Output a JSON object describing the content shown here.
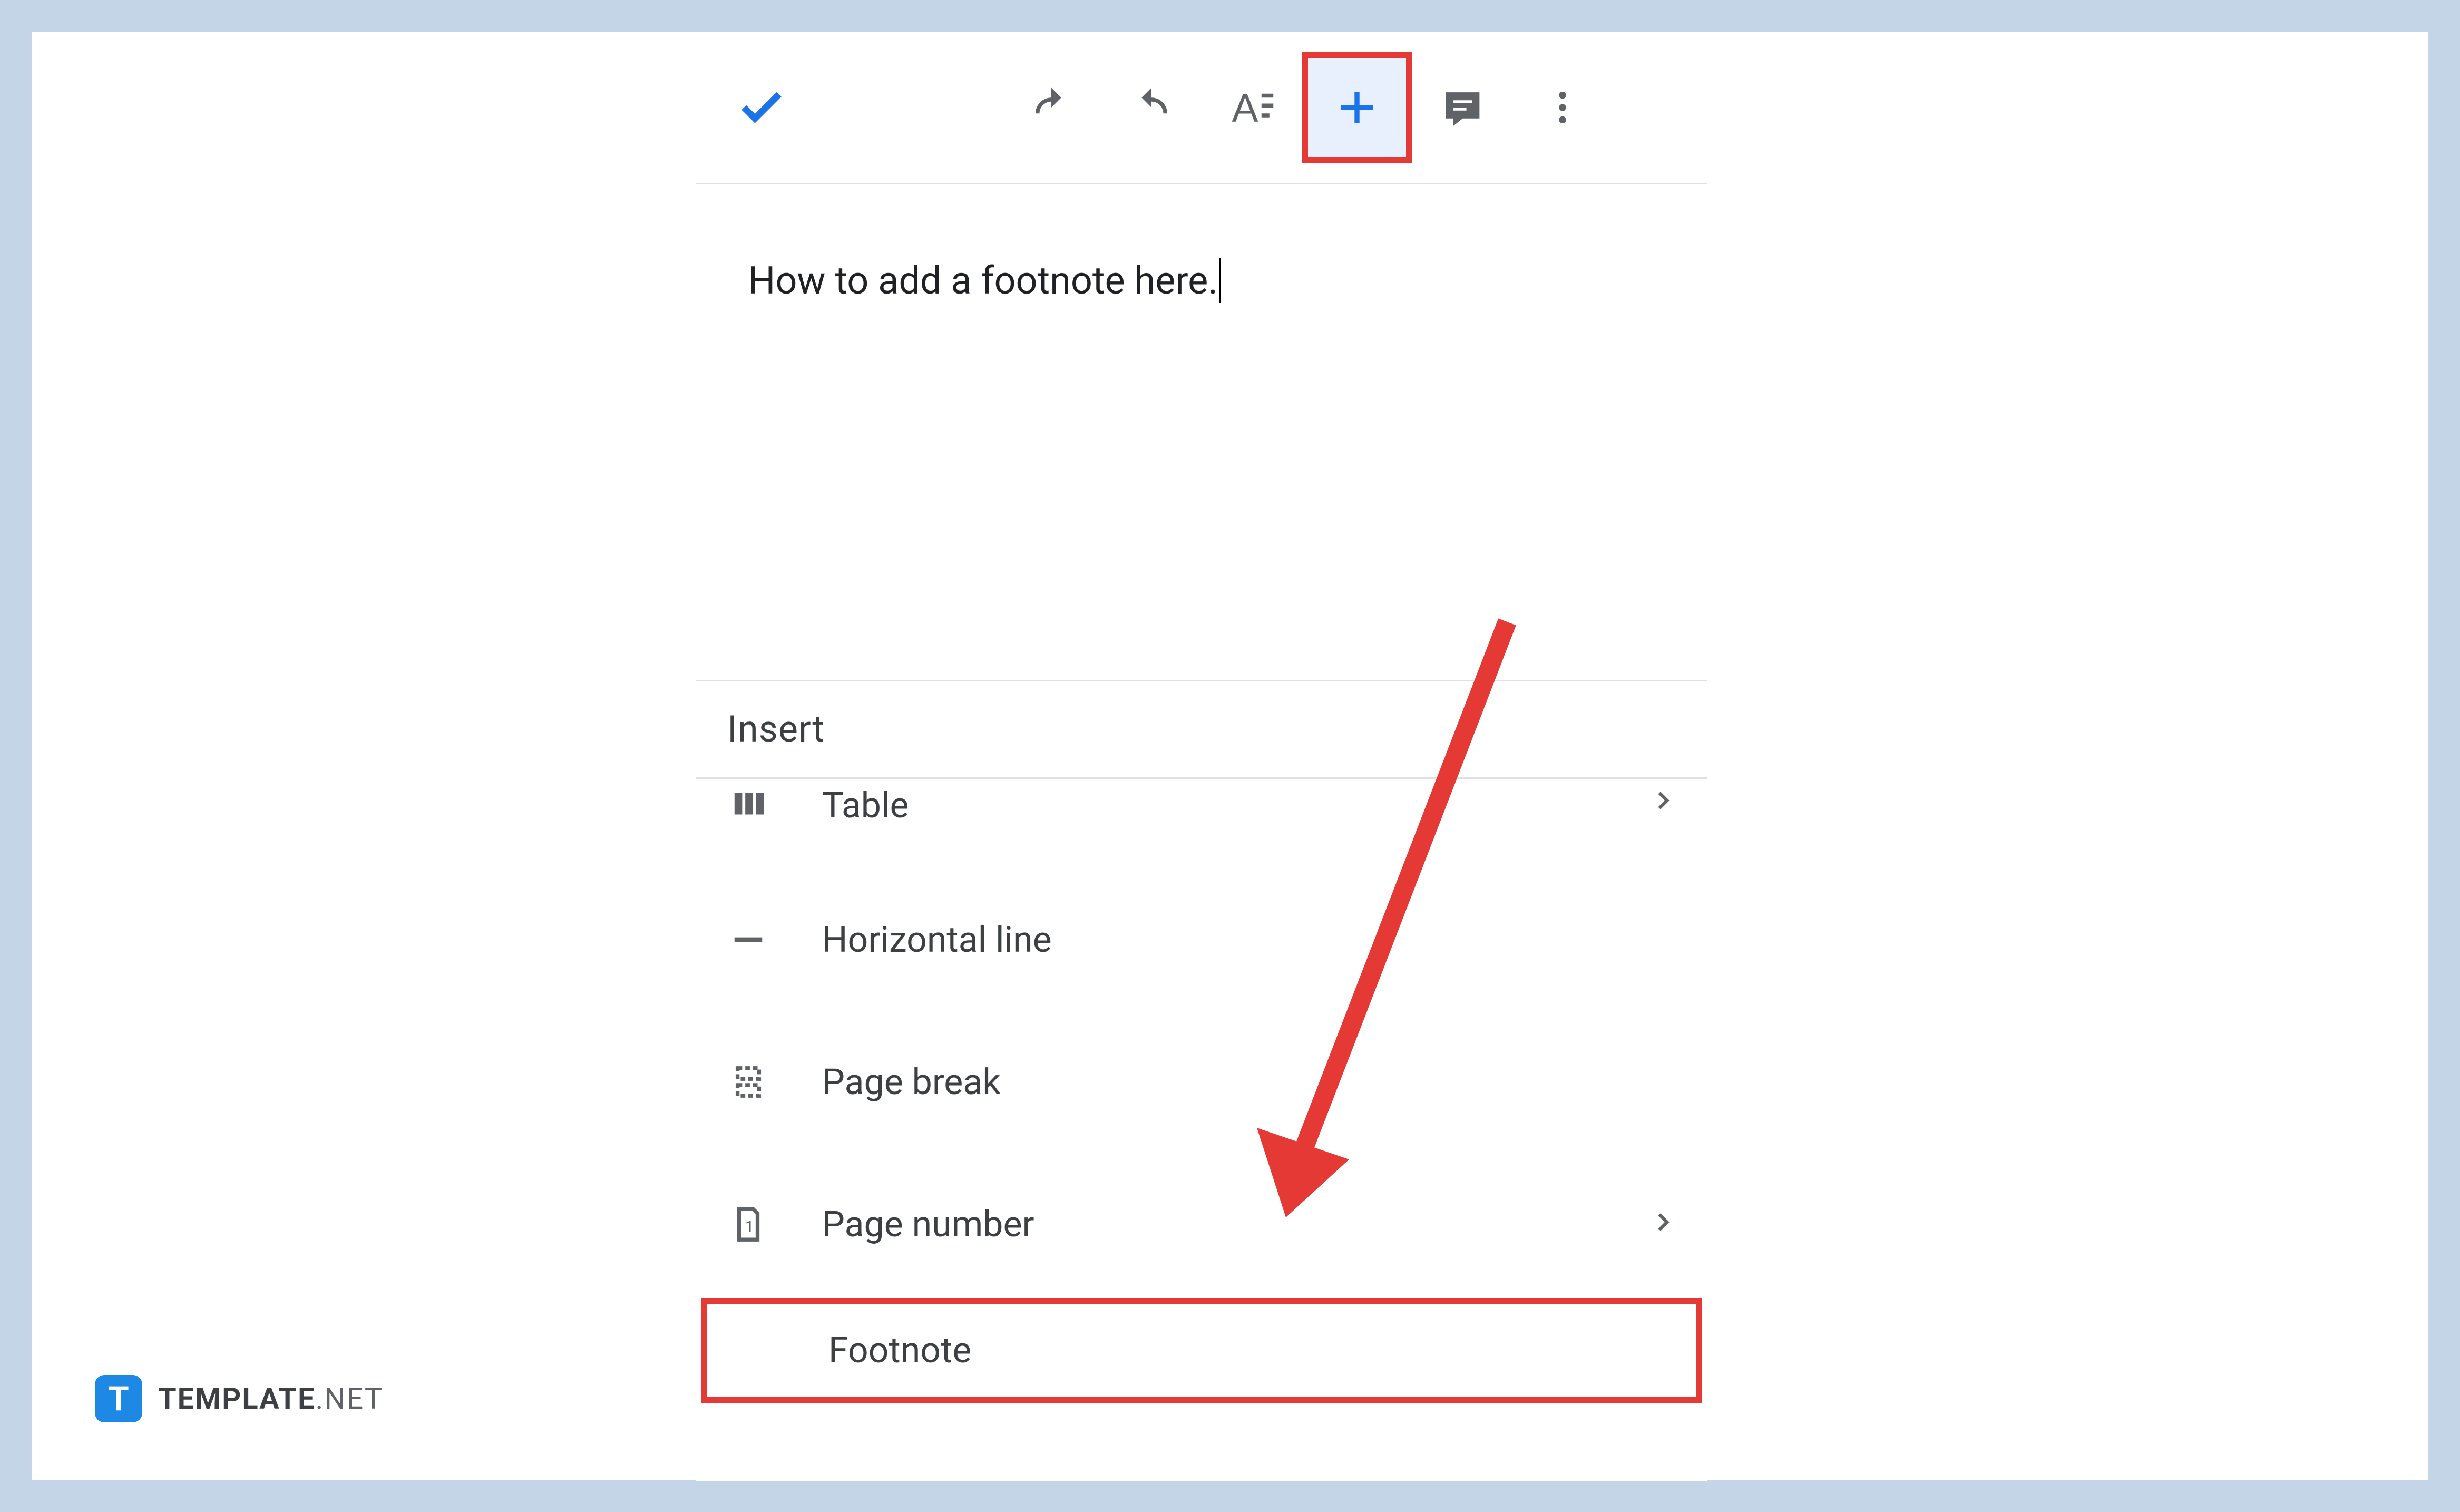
{
  "document": {
    "text": "How to add a footnote here."
  },
  "toolbar": {
    "check": "✓",
    "undo": "↶",
    "redo": "↷",
    "format": "A",
    "plus": "+",
    "comment": "💬",
    "more": "⋮"
  },
  "insert_panel": {
    "title": "Insert",
    "items": [
      {
        "icon": "table-icon",
        "label": "Table",
        "has_submenu": true
      },
      {
        "icon": "hline-icon",
        "label": "Horizontal line",
        "has_submenu": false
      },
      {
        "icon": "pagebreak-icon",
        "label": "Page break",
        "has_submenu": false
      },
      {
        "icon": "pagenum-icon",
        "label": "Page number",
        "has_submenu": true
      },
      {
        "icon": "footnote-icon",
        "label": "Footnote",
        "has_submenu": false
      }
    ]
  },
  "watermark": {
    "badge": "T",
    "brand": "TEMPLATE",
    "suffix": ".NET"
  },
  "highlight_color": "#e53935",
  "accent_color": "#1a73e8"
}
